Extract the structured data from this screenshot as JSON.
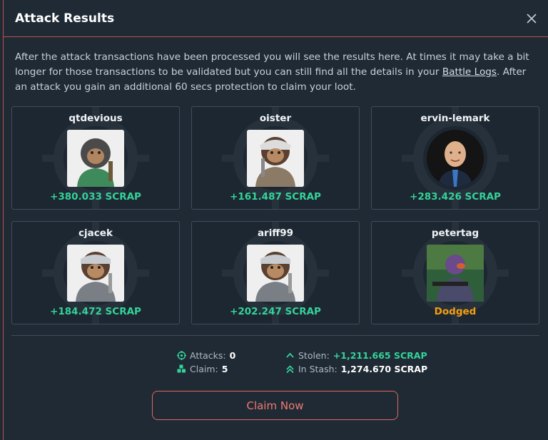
{
  "modal": {
    "title": "Attack Results",
    "description_before": "After the attack transactions have been processed you will see the results here. At times it may take a bit longer for those transactions to be validated but you can still find all the details in your ",
    "description_link": "Battle Logs",
    "description_after": ". After an attack you gain an additional 60 secs protection to claim your loot."
  },
  "targets": [
    {
      "name": "qtdevious",
      "result": "+380.033 SCRAP",
      "status": "success",
      "avatar": "monkey-green-jacket"
    },
    {
      "name": "oister",
      "result": "+161.487 SCRAP",
      "status": "success",
      "avatar": "monkey-wrench"
    },
    {
      "name": "ervin-lemark",
      "result": "+283.426 SCRAP",
      "status": "success",
      "avatar": "human-portrait"
    },
    {
      "name": "cjacek",
      "result": "+184.472 SCRAP",
      "status": "success",
      "avatar": "monkey-bandana"
    },
    {
      "name": "ariff99",
      "result": "+202.247 SCRAP",
      "status": "success",
      "avatar": "monkey-bandana"
    },
    {
      "name": "petertag",
      "result": "Dodged",
      "status": "dodged",
      "avatar": "soldier-jungle"
    }
  ],
  "stats": {
    "attacks_label": "Attacks:",
    "attacks_value": "0",
    "claim_label": "Claim:",
    "claim_value": "5",
    "stolen_label": "Stolen:",
    "stolen_value": "+1,211.665 SCRAP",
    "stash_label": "In Stash:",
    "stash_value": "1,274.670 SCRAP"
  },
  "claim_button": "Claim Now",
  "colors": {
    "success": "#34d399",
    "dodged": "#f59e0b",
    "accent": "#e0685f"
  }
}
